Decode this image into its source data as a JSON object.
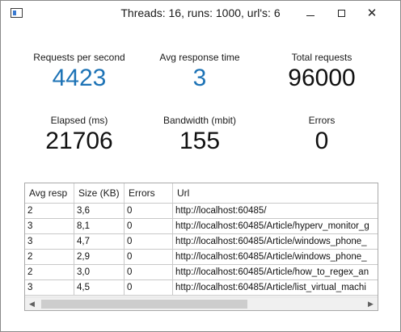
{
  "window": {
    "title": "Threads: 16, runs: 1000, url's: 6",
    "minimize_glyph": "",
    "close_glyph": "✕"
  },
  "stats": [
    {
      "label": "Requests per second",
      "value": "4423",
      "color": "#1d73b6"
    },
    {
      "label": "Avg response time",
      "value": "3",
      "color": "#1d73b6"
    },
    {
      "label": "Total requests",
      "value": "96000",
      "color": "#111111"
    },
    {
      "label": "Elapsed (ms)",
      "value": "21706",
      "color": "#111111"
    },
    {
      "label": "Bandwidth (mbit)",
      "value": "155",
      "color": "#111111"
    },
    {
      "label": "Errors",
      "value": "0",
      "color": "#111111"
    }
  ],
  "grid": {
    "columns": [
      "Avg resp",
      "Size (KB)",
      "Errors",
      "Url"
    ],
    "rows": [
      [
        "2",
        "3,6",
        "0",
        "http://localhost:60485/"
      ],
      [
        "3",
        "8,1",
        "0",
        "http://localhost:60485/Article/hyperv_monitor_g"
      ],
      [
        "3",
        "4,7",
        "0",
        "http://localhost:60485/Article/windows_phone_"
      ],
      [
        "2",
        "2,9",
        "0",
        "http://localhost:60485/Article/windows_phone_"
      ],
      [
        "2",
        "3,0",
        "0",
        "http://localhost:60485/Article/how_to_regex_an"
      ],
      [
        "3",
        "4,5",
        "0",
        "http://localhost:60485/Article/list_virtual_machi"
      ]
    ],
    "scroll_left_glyph": "◀",
    "scroll_right_glyph": "▶"
  }
}
